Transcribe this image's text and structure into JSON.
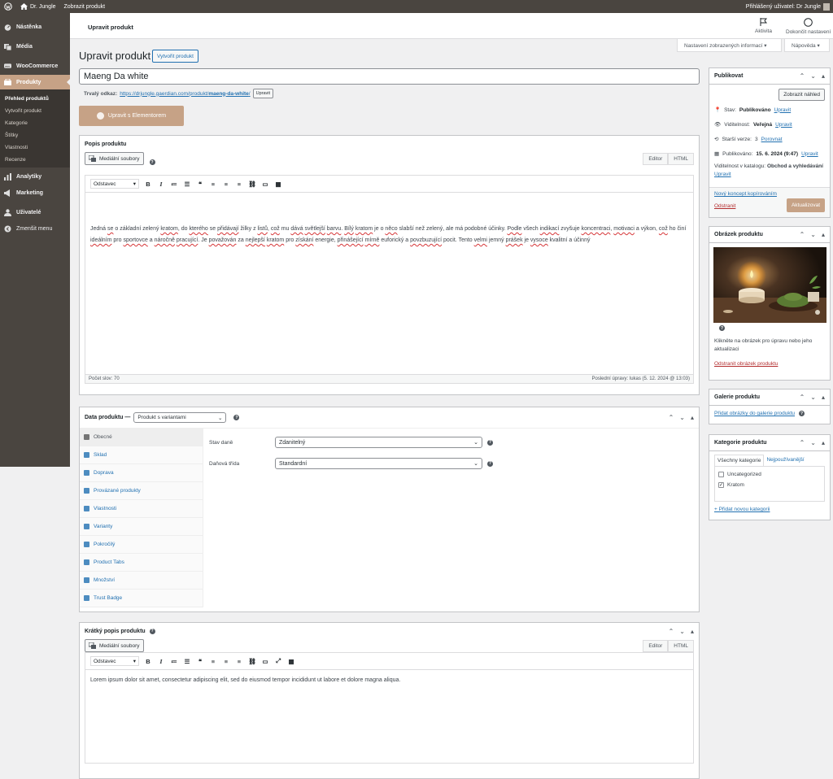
{
  "adminbar": {
    "site": "Dr. Jungle",
    "view": "Zobrazit produkt",
    "user": "Přihlášený uživatel: Dr Jungle"
  },
  "sidebar": {
    "items": [
      {
        "label": "Nástěnka",
        "icon": "dashboard-icon"
      },
      {
        "label": "Média",
        "icon": "media-icon"
      },
      {
        "label": "WooCommerce",
        "icon": "woocommerce-icon"
      },
      {
        "label": "Produkty",
        "icon": "products-icon"
      },
      {
        "label": "Analytiky",
        "icon": "analytics-icon"
      },
      {
        "label": "Marketing",
        "icon": "megaphone-icon"
      },
      {
        "label": "Uživatelé",
        "icon": "users-icon"
      },
      {
        "label": "Zmenšit menu",
        "icon": "collapse-icon"
      }
    ],
    "submenu": [
      "Přehled produktů",
      "Vytvořit produkt",
      "Kategorie",
      "Štítky",
      "Vlastnosti",
      "Recenze"
    ]
  },
  "topbar": {
    "title": "Upravit produkt",
    "activity": "Aktivita",
    "finish": "Dokončit nastavení"
  },
  "screen": {
    "options": "Nastavení zobrazených informací ▾",
    "help": "Nápověda ▾"
  },
  "page": {
    "heading": "Upravit produkt",
    "add_new": "Vytvořit produkt",
    "title_value": "Maeng Da white",
    "permalink_label": "Trvalý odkaz:",
    "permalink_base": "https://drjungle.gaerdian.com/produkt/",
    "permalink_slug": "maeng-da-white",
    "permalink_end": "/",
    "permalink_btn": "Upravit",
    "elementor": "Upravit s Elementorem"
  },
  "description": {
    "title": "Popis produktu",
    "media": "Mediální soubory",
    "tab_editor": "Editor",
    "tab_html": "HTML",
    "format": "Odstavec",
    "words": "Počet slov: 70",
    "last_edit": "Poslední úpravy: lukas (5. 12. 2024 @ 13:03)"
  },
  "product_data": {
    "title": "Data produktu —",
    "type": "Produkt s variantami",
    "tabs": [
      "Obecné",
      "Sklad",
      "Doprava",
      "Provázané produkty",
      "Vlastnosti",
      "Varianty",
      "Pokročilý",
      "Product Tabs",
      "Množství",
      "Trust Badge"
    ],
    "tax_status_label": "Stav daně",
    "tax_status": "Zdanitelný",
    "tax_class_label": "Daňová třída",
    "tax_class": "Standardní"
  },
  "short": {
    "title": "Krátký popis produktu",
    "media": "Mediální soubory",
    "tab_editor": "Editor",
    "tab_html": "HTML",
    "format": "Odstavec",
    "text": "Lorem ipsum dolor sit amet, consectetur adipiscing elit, sed do eiusmod tempor incididunt ut labore et dolore magna aliqua."
  },
  "publish": {
    "title": "Publikovat",
    "preview": "Zobrazit náhled",
    "status_label": "Stav:",
    "status": "Publikováno",
    "visibility_label": "Viditelnost:",
    "visibility": "Veřejná",
    "revisions_label": "Starší verze:",
    "revisions": "3",
    "compare": "Porovnat",
    "published_label": "Publikováno:",
    "published": "15. 6. 2024 (9:47)",
    "edit": "Upravit",
    "catalog_label": "Viditelnost v katalogu:",
    "catalog": "Obchod a vyhledávání",
    "copy": "Nový koncept kopírováním",
    "trash": "Odstranit",
    "update": "Aktualizovat"
  },
  "image": {
    "title": "Obrázek produktu",
    "hint": "Klikněte na obrázek pro úpravu nebo jeho aktualizaci",
    "remove": "Odstranit obrázek produktu"
  },
  "gallery": {
    "title": "Galerie produktu",
    "add": "Přidat obrázky do galerie produktu"
  },
  "categories": {
    "title": "Kategorie produktu",
    "tab_all": "Všechny kategorie",
    "tab_used": "Nejpoužívanější",
    "items": [
      {
        "label": "Uncategorized",
        "checked": false
      },
      {
        "label": "Kratom",
        "checked": true
      }
    ],
    "add": "+ Přidat novou kategorii"
  }
}
